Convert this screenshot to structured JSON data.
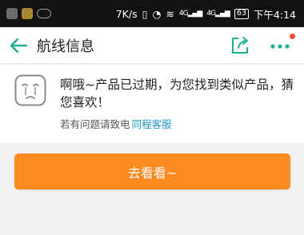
{
  "status_bar": {
    "net_speed": "7K/s",
    "signal_a": "4G",
    "signal_b": "4G",
    "battery": "63",
    "time": "下午4:14"
  },
  "app_bar": {
    "title": "航线信息",
    "icons": [
      "back-arrow-icon",
      "share-icon",
      "more-icon"
    ],
    "accent": "#1ab394"
  },
  "message": {
    "text": "啊哦~产品已过期，为您找到类似产品，猜您喜欢！",
    "help_prefix": "若有问题请致电",
    "help_link": "同程客服"
  },
  "cta": {
    "label": "去看看~",
    "color": "#fc8a1f"
  }
}
